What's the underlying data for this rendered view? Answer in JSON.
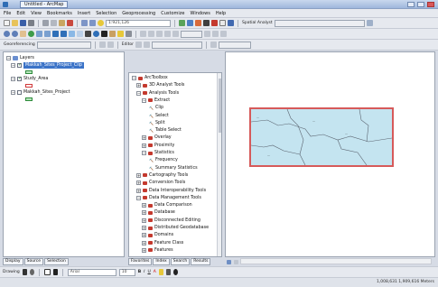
{
  "window": {
    "tab_title": "Untitled - ArcMap"
  },
  "menu": [
    "File",
    "Edit",
    "View",
    "Bookmarks",
    "Insert",
    "Selection",
    "Geoprocessing",
    "Customize",
    "Windows",
    "Help"
  ],
  "toolbar": {
    "scale": "1:921,126",
    "spatial_analyst_label": "Spatial Analyst",
    "georeferencing_label": "Georeferencing",
    "editor_label": "Editor"
  },
  "colors": {
    "selection": "#3b73c8",
    "toolbox_icon": "#c4392e",
    "map_frame_border": "#d65a5a",
    "map_fill": "#c4e4f0",
    "layer_fill": "#b7e5bd"
  },
  "toc": {
    "root_label": "Layers",
    "layers": [
      {
        "label": "Makkah_Sites_Project_Clip",
        "checked": true,
        "selected": true
      },
      {
        "label": "Study_Area",
        "checked": true,
        "selected": false
      },
      {
        "label": "Makkah_Sites_Project",
        "checked": false,
        "selected": false
      }
    ],
    "tabs": [
      "Display",
      "Source",
      "Selection"
    ]
  },
  "toolbox": {
    "items": [
      {
        "label": "ArcToolbox",
        "level": 0,
        "type": "root"
      },
      {
        "label": "3D Analyst Tools",
        "level": 1,
        "type": "toolbox"
      },
      {
        "label": "Analysis Tools",
        "level": 1,
        "type": "toolbox"
      },
      {
        "label": "Extract",
        "level": 2,
        "type": "toolset"
      },
      {
        "label": "Clip",
        "level": 3,
        "type": "tool"
      },
      {
        "label": "Select",
        "level": 3,
        "type": "tool"
      },
      {
        "label": "Split",
        "level": 3,
        "type": "tool"
      },
      {
        "label": "Table Select",
        "level": 3,
        "type": "tool"
      },
      {
        "label": "Overlay",
        "level": 2,
        "type": "toolset"
      },
      {
        "label": "Proximity",
        "level": 2,
        "type": "toolset"
      },
      {
        "label": "Statistics",
        "level": 2,
        "type": "toolset"
      },
      {
        "label": "Frequency",
        "level": 3,
        "type": "tool"
      },
      {
        "label": "Summary Statistics",
        "level": 3,
        "type": "tool"
      },
      {
        "label": "Cartography Tools",
        "level": 1,
        "type": "toolbox"
      },
      {
        "label": "Conversion Tools",
        "level": 1,
        "type": "toolbox"
      },
      {
        "label": "Data Interoperability Tools",
        "level": 1,
        "type": "toolbox"
      },
      {
        "label": "Data Management Tools",
        "level": 1,
        "type": "toolbox"
      },
      {
        "label": "Data Comparison",
        "level": 2,
        "type": "toolset"
      },
      {
        "label": "Database",
        "level": 2,
        "type": "toolset"
      },
      {
        "label": "Disconnected Editing",
        "level": 2,
        "type": "toolset"
      },
      {
        "label": "Distributed Geodatabase",
        "level": 2,
        "type": "toolset"
      },
      {
        "label": "Domains",
        "level": 2,
        "type": "toolset"
      },
      {
        "label": "Feature Class",
        "level": 2,
        "type": "toolset"
      },
      {
        "label": "Features",
        "level": 2,
        "type": "toolset"
      }
    ],
    "tabs": [
      "Favorites",
      "Index",
      "Search",
      "Results"
    ]
  },
  "drawing": {
    "label": "Drawing",
    "font": "Arial",
    "size": "10"
  },
  "status": {
    "coordinates": "1,008,631  1,909,616 Meters"
  }
}
